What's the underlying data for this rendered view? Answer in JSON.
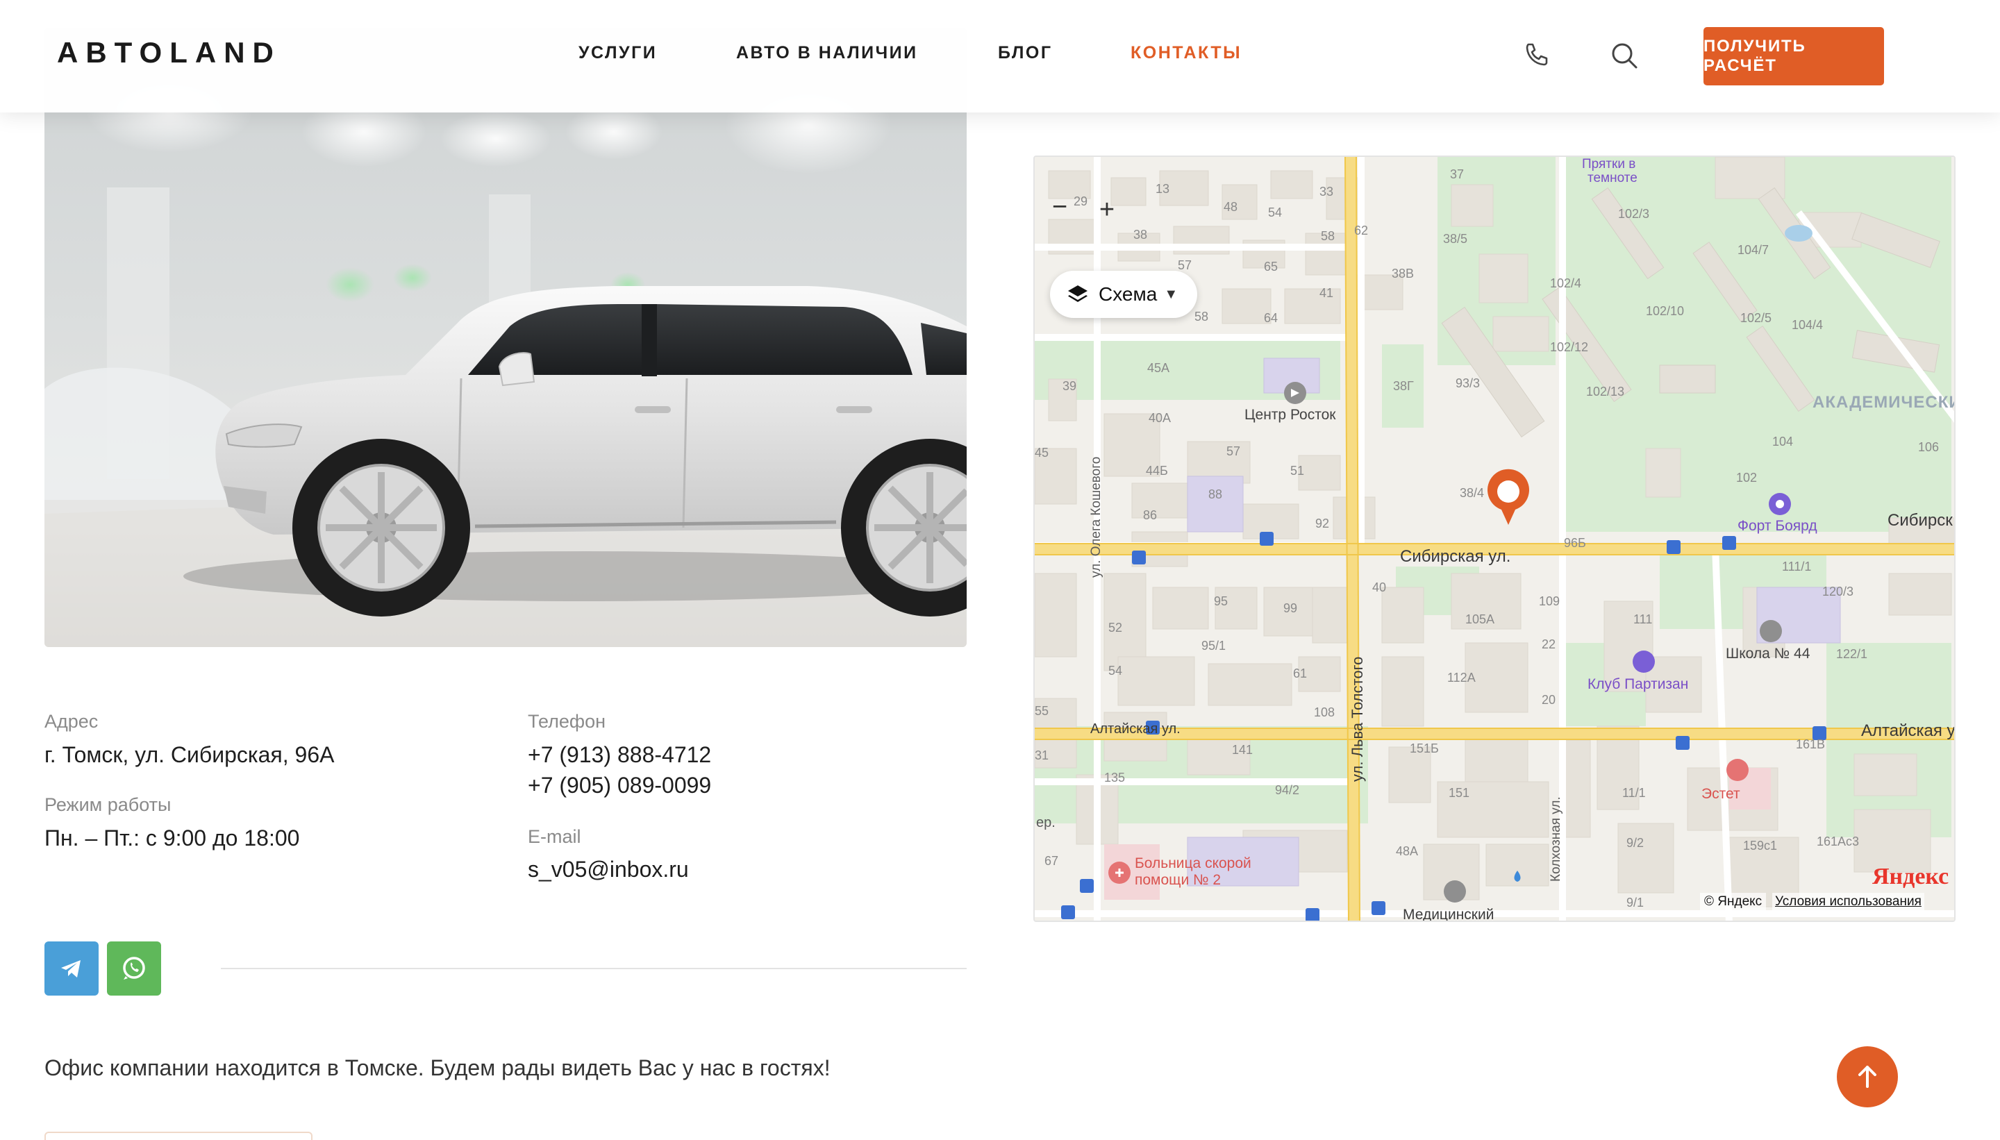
{
  "header": {
    "logo": "ABTOLAND",
    "nav": [
      {
        "label": "УСЛУГИ",
        "active": false
      },
      {
        "label": "АВТО В НАЛИЧИИ",
        "active": false
      },
      {
        "label": "БЛОГ",
        "active": false
      },
      {
        "label": "КОНТАКТЫ",
        "active": true
      }
    ],
    "phone_icon": "phone-icon",
    "search_icon": "search-icon",
    "cta_label": "ПОЛУЧИТЬ РАСЧЁТ"
  },
  "contacts": {
    "address_label": "Адрес",
    "address": "г. Томск, ул. Сибирская, 96А",
    "hours_label": "Режим работы",
    "hours": "Пн. – Пт.: с 9:00 до 18:00",
    "phone_label": "Телефон",
    "phones": [
      "+7 (913) 888-4712",
      "+7 (905) 089-0099"
    ],
    "email_label": "E-mail",
    "email": "s_v05@inbox.ru"
  },
  "social": [
    {
      "name": "telegram",
      "icon": "telegram-icon",
      "color": "#4a9fd8"
    },
    {
      "name": "whatsapp",
      "icon": "whatsapp-icon",
      "color": "#5fb85a"
    }
  ],
  "about_text": "Офис компании находится в Томске. Будем рады видеть Вас у нас в гостях!",
  "colors": {
    "accent": "#e05d26",
    "telegram": "#4a9fd8",
    "whatsapp": "#5fb85a"
  },
  "map": {
    "scheme_label": "Схема",
    "zoom_in": "+",
    "zoom_out": "−",
    "copyright": "© Яндекс",
    "terms": "Условия использования",
    "logo": "Яндекс",
    "streets": {
      "sibirskaya": "Сибирская ул.",
      "sibirskaya_right": "Сибирск",
      "altayskaya_left": "Алтайская ул.",
      "altayskaya_right": "Алтайская у",
      "lva_tolstogo": "ул. Льва Толстого",
      "olega_koshevogo": "ул. Олега Кошевого",
      "kolkhoznaya": "Колхозная ул.",
      "medicinsky": "Медицинский",
      "per": "ер."
    },
    "pois": {
      "center": "Центр Росток",
      "fort": "Форт Боярд",
      "school": "Школа № 44",
      "club": "Клуб Партизан",
      "estet": "Эстет",
      "hospital_1": "Больница скорой",
      "hospital_2": "помощи № 2",
      "pryatki_1": "Прятки в",
      "pryatki_2": "темноте",
      "district": "АКАДЕМИЧЕСКИ"
    },
    "numbers": [
      "37",
      "13",
      "33",
      "48",
      "54",
      "29",
      "38",
      "58",
      "62",
      "38/5",
      "102/3",
      "57",
      "65",
      "41",
      "104/7",
      "38В",
      "102/4",
      "102/10",
      "102/5",
      "104/4",
      "64",
      "58",
      "45А",
      "102/12",
      "39",
      "38Г",
      "93/3",
      "102/13",
      "40А",
      "104",
      "106",
      "45",
      "57",
      "44Б",
      "51",
      "102",
      "38/4",
      "88",
      "86",
      "92",
      "96Б",
      "111/1",
      "120/3",
      "40",
      "95",
      "99",
      "109",
      "105А",
      "111",
      "52",
      "95/1",
      "22",
      "122/1",
      "54",
      "61",
      "112А",
      "20",
      "55",
      "108",
      "31",
      "141",
      "151Б",
      "161В",
      "135",
      "94/2",
      "151",
      "11/1",
      "9/2",
      "159с1",
      "161Ас3",
      "67",
      "48А",
      "9/1"
    ]
  }
}
